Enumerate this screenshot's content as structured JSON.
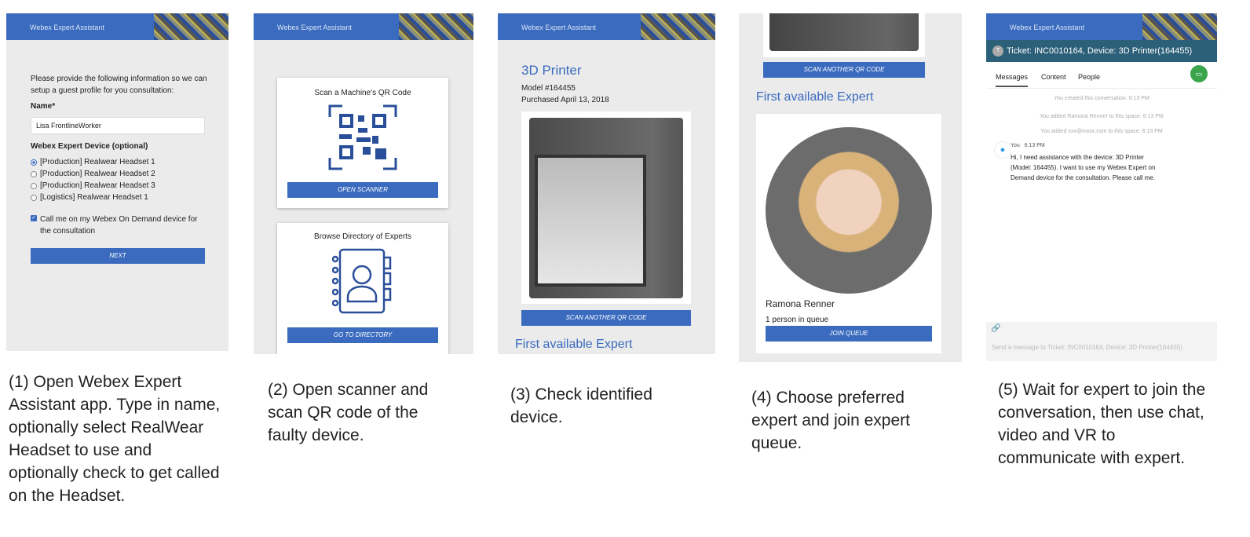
{
  "app_title": "Webex Expert Assistant",
  "panel1": {
    "intro": "Please provide the following information so we can setup a guest profile for you consultation:",
    "name_label": "Name*",
    "name_value": "Lisa FrontlineWorker",
    "device_label": "Webex Expert Device (optional)",
    "devices": [
      "[Production] Realwear Headset 1",
      "[Production] Realwear Headset 2",
      "[Production] Realwear Headset 3",
      "[Logistics] Realwear Headset 1"
    ],
    "callme": "Call me on my Webex On Demand device for the consultation",
    "next": "NEXT"
  },
  "panel2": {
    "scan_title": "Scan a Machine's QR Code",
    "open_scanner": "OPEN SCANNER",
    "browse_title": "Browse Directory of Experts",
    "go_directory": "GO TO DIRECTORY"
  },
  "panel3": {
    "device": "3D Printer",
    "model": "Model #164455",
    "purchased": "Purchased April 13, 2018",
    "scan_another": "SCAN ANOTHER QR CODE",
    "first_expert": "First available Expert"
  },
  "panel4": {
    "scan_another": "SCAN ANOTHER QR CODE",
    "first_expert": "First available Expert",
    "expert_name": "Ramona Renner",
    "queue": "1 person in queue",
    "join": "JOIN QUEUE"
  },
  "panel5": {
    "avatar": "T",
    "ticket": "Ticket: INC0010164, Device: 3D Printer(164455)",
    "tabs": [
      "Messages",
      "Content",
      "People"
    ],
    "sys": [
      "You created this conversation. 6:13 PM",
      "You added Ramona Renner to this space. 6:13 PM",
      "You added xxx@mxxx.com to this space. 6:13 PM"
    ],
    "sender": "You",
    "time": "6:13 PM",
    "message": "Hi, I need assistance with the device: 3D Printer (Model: 164455). I want to use my Webex Expert on Demand device for the consultation. Please call me.",
    "placeholder": "Send a message to Ticket: INC0010164, Device: 3D Printer(164455)"
  },
  "captions": [
    "(1) Open Webex Expert Assistant app. Type in name, optionally select RealWear Headset to use and optionally check to get called on the Headset.",
    "(2) Open scanner and scan QR code of the faulty device.",
    "(3) Check identified device.",
    "(4) Choose preferred expert and join expert queue.",
    "(5) Wait for expert to join the conversation, then use chat, video and VR to communicate with expert."
  ]
}
